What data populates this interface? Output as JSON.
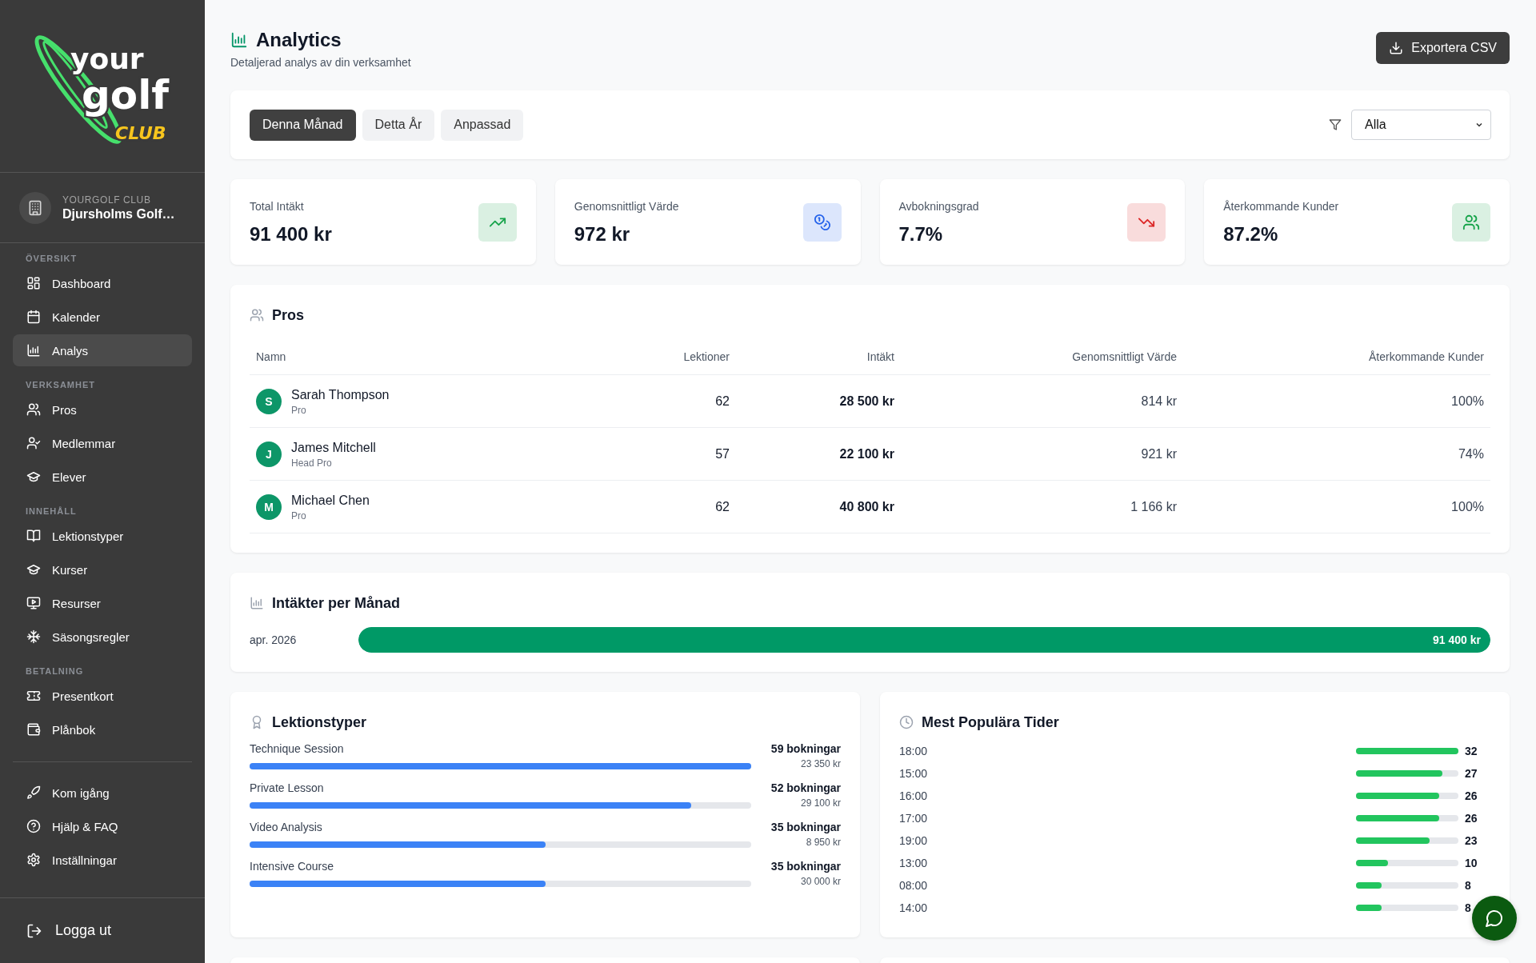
{
  "sidebar": {
    "logo": {
      "line_1": "your",
      "line_2": "golf",
      "line_3": "CLUB"
    },
    "club": {
      "caption": "YOURGOLF CLUB",
      "name": "Djursholms Golf…"
    },
    "sections": [
      {
        "label": "ÖVERSIKT",
        "items": [
          {
            "label": "Dashboard",
            "selected": false
          },
          {
            "label": "Kalender",
            "selected": false
          },
          {
            "label": "Analys",
            "selected": true
          }
        ]
      },
      {
        "label": "VERKSAMHET",
        "items": [
          {
            "label": "Pros",
            "selected": false
          },
          {
            "label": "Medlemmar",
            "selected": false
          },
          {
            "label": "Elever",
            "selected": false
          }
        ]
      },
      {
        "label": "INNEHÅLL",
        "items": [
          {
            "label": "Lektionstyper",
            "selected": false
          },
          {
            "label": "Kurser",
            "selected": false
          },
          {
            "label": "Resurser",
            "selected": false
          },
          {
            "label": "Säsongsregler",
            "selected": false
          }
        ]
      },
      {
        "label": "BETALNING",
        "items": [
          {
            "label": "Presentkort",
            "selected": false
          },
          {
            "label": "Plånbok",
            "selected": false
          }
        ]
      }
    ],
    "footer_items": [
      {
        "label": "Kom igång",
        "selected": false
      },
      {
        "label": "Hjälp & FAQ",
        "selected": false
      },
      {
        "label": "Inställningar",
        "selected": false
      }
    ],
    "logout": "Logga ut"
  },
  "header": {
    "title": "Analytics",
    "subtitle": "Detaljerad analys av din verksamhet",
    "export_button": "Exportera CSV"
  },
  "period_tabs": [
    {
      "label": "Denna Månad",
      "selected": true
    },
    {
      "label": "Detta År",
      "selected": false
    },
    {
      "label": "Anpassad",
      "selected": false
    }
  ],
  "filter": {
    "value": "Alla"
  },
  "stats": [
    {
      "label": "Total Intäkt",
      "value": "91 400 kr",
      "kind": "growth",
      "color": "#16a34a"
    },
    {
      "label": "Genomsnittligt Värde",
      "value": "972 kr",
      "kind": "coins",
      "color": "#2563eb"
    },
    {
      "label": "Avbokningsgrad",
      "value": "7.7%",
      "kind": "decline",
      "color": "#dc2626"
    },
    {
      "label": "Återkommande Kunder",
      "value": "87.2%",
      "kind": "customers",
      "color": "#16a34a"
    }
  ],
  "pros": {
    "title": "Pros",
    "columns": [
      "Namn",
      "Lektioner",
      "Intäkt",
      "Genomsnittligt Värde",
      "Återkommande Kunder"
    ],
    "rows": [
      {
        "initial": "S",
        "name": "Sarah Thompson",
        "role": "Pro",
        "lessons": "62",
        "revenue": "28 500 kr",
        "average": "814 kr",
        "returning": "100%"
      },
      {
        "initial": "J",
        "name": "James Mitchell",
        "role": "Head Pro",
        "lessons": "57",
        "revenue": "22 100 kr",
        "average": "921 kr",
        "returning": "74%"
      },
      {
        "initial": "M",
        "name": "Michael Chen",
        "role": "Pro",
        "lessons": "62",
        "revenue": "40 800 kr",
        "average": "1 166 kr",
        "returning": "100%"
      }
    ]
  },
  "monthly_revenue": {
    "title": "Intäkter per Månad",
    "rows": [
      {
        "label": "apr. 2026",
        "value": "91 400 kr",
        "level": 1
      }
    ]
  },
  "lesson_types": {
    "title": "Lektionstyper",
    "rows": [
      {
        "name": "Technique Session",
        "bookings": "59 bokningar",
        "revenue": "23 350 kr",
        "level": 1
      },
      {
        "name": "Private Lesson",
        "bookings": "52 bokningar",
        "revenue": "29 100 kr",
        "level": 0.88
      },
      {
        "name": "Video Analysis",
        "bookings": "35 bokningar",
        "revenue": "8 950 kr",
        "level": 0.59
      },
      {
        "name": "Intensive Course",
        "bookings": "35 bokningar",
        "revenue": "30 000 kr",
        "level": 0.59
      }
    ]
  },
  "popular_times": {
    "title": "Mest Populära Tider",
    "rows": [
      {
        "time": "18:00",
        "count": "32",
        "level": 1
      },
      {
        "time": "15:00",
        "count": "27",
        "level": 0.84
      },
      {
        "time": "16:00",
        "count": "26",
        "level": 0.81
      },
      {
        "time": "17:00",
        "count": "26",
        "level": 0.81
      },
      {
        "time": "19:00",
        "count": "23",
        "level": 0.72
      },
      {
        "time": "13:00",
        "count": "10",
        "level": 0.31
      },
      {
        "time": "08:00",
        "count": "8",
        "level": 0.25
      },
      {
        "time": "14:00",
        "count": "8",
        "level": 0.25
      }
    ]
  }
}
